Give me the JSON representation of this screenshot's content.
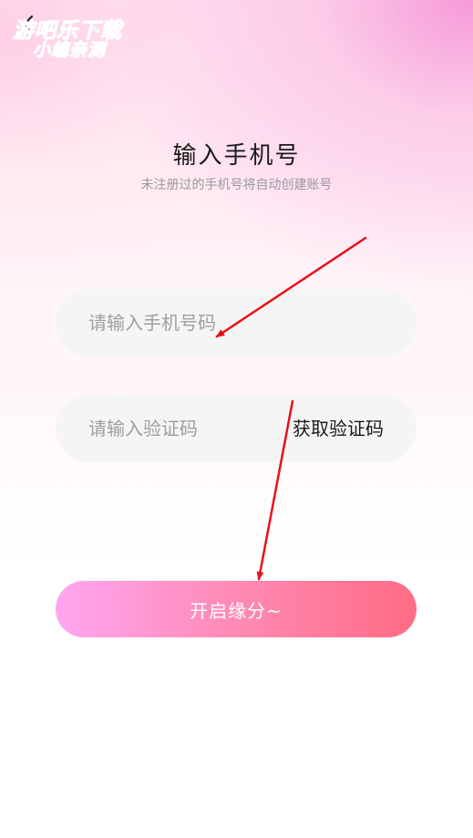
{
  "watermark": {
    "line1": "游吧乐下载",
    "line2": "小编亲测"
  },
  "header": {
    "back_icon": "back-arrow-icon"
  },
  "page": {
    "title": "输入手机号",
    "subtitle": "未注册过的手机号将自动创建账号"
  },
  "phone_field": {
    "placeholder": "请输入手机号码",
    "value": ""
  },
  "code_field": {
    "placeholder": "请输入验证码",
    "value": "",
    "get_code_label": "获取验证码"
  },
  "submit": {
    "label": "开启缘分~"
  },
  "colors": {
    "button_gradient_start": "#ffa6f0",
    "button_gradient_end": "#ff6b84",
    "annotation_arrow": "#e8101a",
    "watermark": "#4fc9df"
  }
}
